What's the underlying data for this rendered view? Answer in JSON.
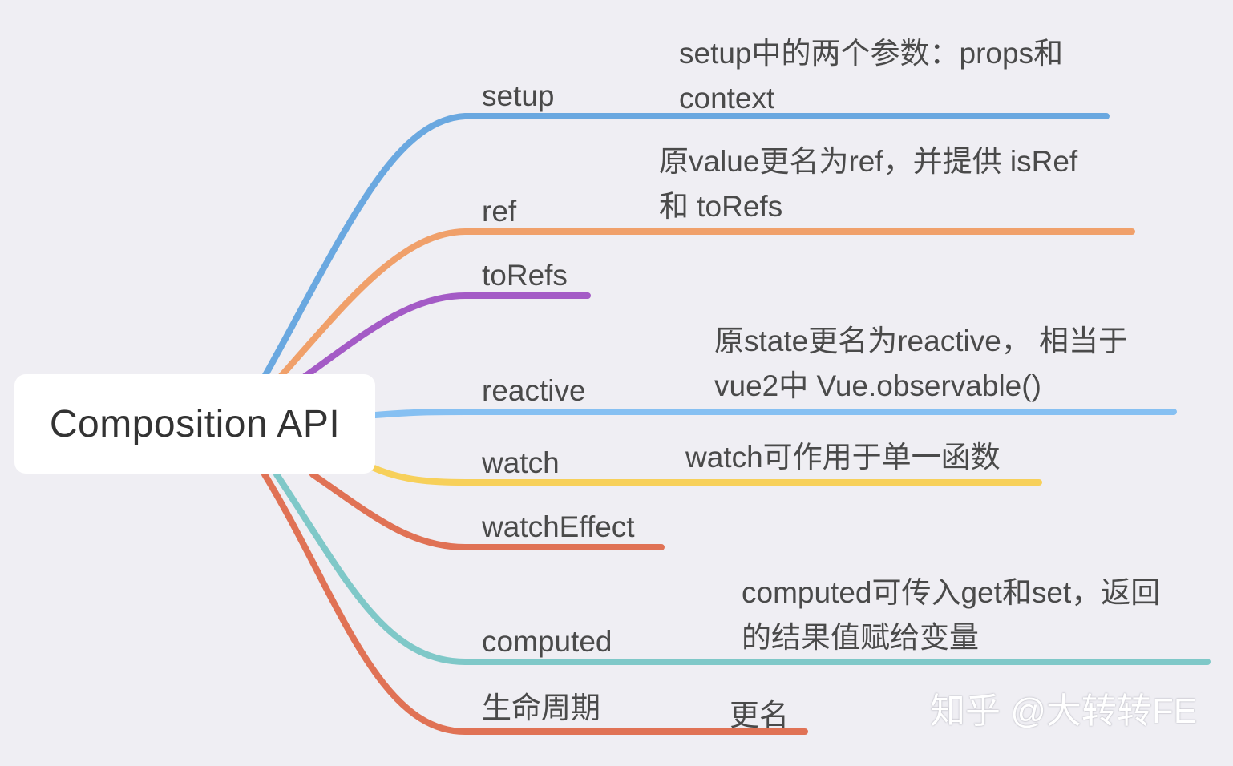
{
  "root": {
    "label": "Composition API"
  },
  "branches": [
    {
      "id": "setup",
      "label": "setup",
      "color": "#6aa8e0",
      "note": "setup中的两个参数：props和\ncontext"
    },
    {
      "id": "ref",
      "label": "ref",
      "color": "#f0a06a",
      "note": "原value更名为ref，并提供 isRef\n和 toRefs"
    },
    {
      "id": "torefs",
      "label": "toRefs",
      "color": "#a45bc6",
      "note": ""
    },
    {
      "id": "reactive",
      "label": "reactive",
      "color": "#86c0f2",
      "note": "原state更名为reactive， 相当于\nvue2中 Vue.observable()"
    },
    {
      "id": "watch",
      "label": "watch",
      "color": "#f7d05a",
      "note": "watch可作用于单一函数"
    },
    {
      "id": "watcheffect",
      "label": "watchEffect",
      "color": "#e07255",
      "note": ""
    },
    {
      "id": "computed",
      "label": "computed",
      "color": "#7fc8c8",
      "note": "computed可传入get和set，返回\n的结果值赋给变量"
    },
    {
      "id": "lifecycle",
      "label": "生命周期",
      "color": "#e07255",
      "note": "更名"
    }
  ],
  "watermark": "知乎 @大转转FE"
}
